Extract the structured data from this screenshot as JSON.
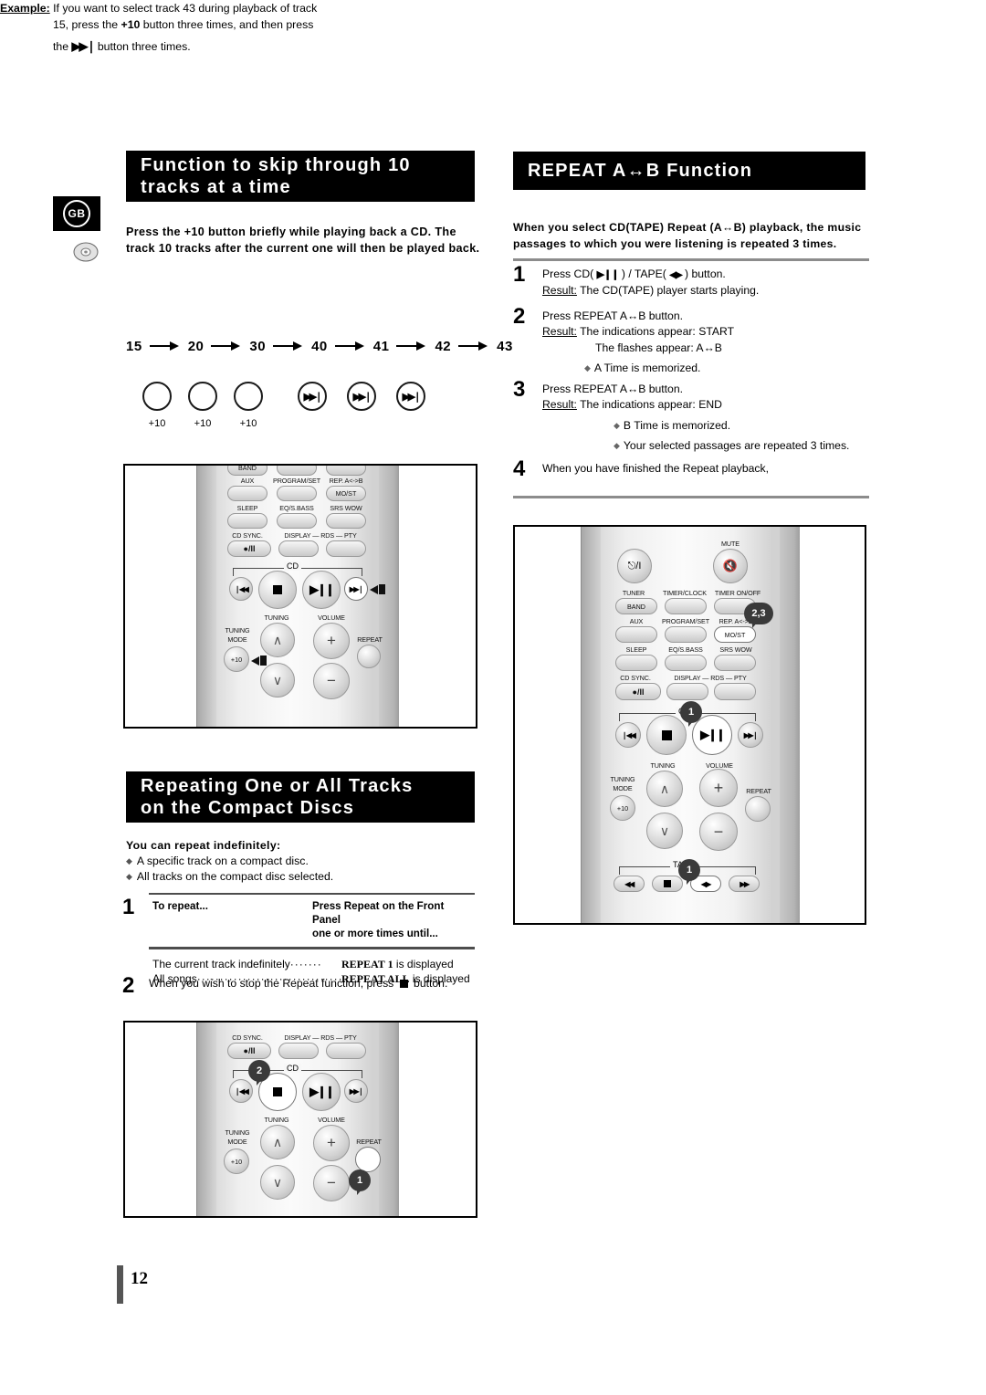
{
  "page": {
    "number": "12",
    "language_tab": "GB"
  },
  "sections": {
    "skip": {
      "title_line1": "Function to skip through 10",
      "title_line2": "tracks at a time",
      "intro": "Press the +10 button briefly while playing back a CD. The track 10 tracks after the current one will then be played back.",
      "example_label": "Example:",
      "example_line1": "If you want to select track 43 during playback of track",
      "example_line2_a": "15, press the ",
      "example_line2_b": "+10",
      "example_line2_c": " button three times, and then press",
      "example_line3_a": "the ",
      "example_line3_b": " button three times.",
      "flow": [
        "15",
        "20",
        "30",
        "40",
        "41",
        "42",
        "43"
      ],
      "button_captions": [
        "+10",
        "+10",
        "+10"
      ]
    },
    "repeat_ab": {
      "title": "REPEAT A↔B Function",
      "intro": "When you select CD(TAPE) Repeat (A↔B) playback, the music passages to which you were listening is repeated 3 times.",
      "steps": [
        {
          "num": "1",
          "line1_a": "Press CD( ",
          "line1_b": " ) / TAPE( ",
          "line1_c": " ) button.",
          "result_label": "Result:",
          "result_text": "The CD(TAPE) player starts playing."
        },
        {
          "num": "2",
          "line1": "Press REPEAT A↔B button.",
          "result_label": "Result:",
          "result_text": "The indications appear: START",
          "result_text2": "The flashes appear: A↔B",
          "bullets": [
            "A Time is memorized."
          ]
        },
        {
          "num": "3",
          "line1": "Press REPEAT A↔B button.",
          "result_label": "Result:",
          "result_text": "The indications appear:  END",
          "bullets": [
            "B Time is memorized.",
            "Your selected passages are repeated 3 times."
          ]
        },
        {
          "num": "4",
          "line1": "When you have finished the Repeat playback,"
        }
      ]
    },
    "repeat_tracks": {
      "title_line1": "Repeating One or All Tracks",
      "title_line2": "on the Compact Discs",
      "intro": "You can repeat indefinitely:",
      "bullets": [
        "A specific track on a compact disc.",
        "All tracks on the compact disc selected."
      ],
      "step1_num": "1",
      "table": {
        "header_left": "To repeat...",
        "header_right_line1": "Press Repeat on the Front Panel",
        "header_right_line2": "one or more times until...",
        "rows": [
          {
            "left": "The current track indefinitely",
            "dots": "·······",
            "right": "REPEAT 1",
            "right_tail": " is displayed"
          },
          {
            "left": "All songs",
            "dots": "································",
            "right": "REPEAT ALL",
            "right_tail": " is displayed"
          }
        ]
      },
      "step2_num": "2",
      "step2_text_a": "When you wish to stop the Repeat function, press ",
      "step2_text_b": " button."
    }
  },
  "remote_top_left": {
    "rows": [
      {
        "labels": [
          "",
          "",
          ""
        ],
        "buttons": [
          "BAND",
          "",
          ""
        ]
      },
      {
        "labels": [
          "AUX",
          "PROGRAM/SET",
          "REP. A<->B"
        ],
        "buttons": [
          "",
          "",
          "MO/ST"
        ]
      },
      {
        "labels": [
          "SLEEP",
          "EQ/S.BASS",
          "SRS WOW"
        ],
        "buttons": [
          "",
          "",
          ""
        ]
      },
      {
        "labels": [
          "CD SYNC.",
          "DISPLAY — RDS — PTY",
          ""
        ],
        "buttons": [
          "●/II",
          "",
          ""
        ]
      }
    ],
    "cd_label": "CD",
    "tuning_label": "TUNING",
    "volume_label": "VOLUME",
    "tuning_mode_label_1": "TUNING",
    "tuning_mode_label_2": "MODE",
    "plus10_label": "+10",
    "repeat_label": "REPEAT"
  },
  "remote_right": {
    "power_label": "/I",
    "mute_label": "MUTE",
    "rows": [
      {
        "labels": [
          "TUNER",
          "TIMER/CLOCK",
          "TIMER ON/OFF"
        ],
        "buttons": [
          "BAND",
          "",
          ""
        ]
      },
      {
        "labels": [
          "AUX",
          "PROGRAM/SET",
          "REP. A<->B"
        ],
        "buttons": [
          "",
          "",
          "MO/ST"
        ]
      },
      {
        "labels": [
          "SLEEP",
          "EQ/S.BASS",
          "SRS WOW"
        ],
        "buttons": [
          "",
          "",
          ""
        ]
      },
      {
        "labels": [
          "CD SYNC.",
          "DISPLAY — RDS — PTY",
          ""
        ],
        "buttons": [
          "●/II",
          "",
          ""
        ]
      }
    ],
    "cd_label": "CD",
    "tape_label": "TAPE",
    "tuning_label": "TUNING",
    "volume_label": "VOLUME",
    "tuning_mode_label_1": "TUNING",
    "tuning_mode_label_2": "MODE",
    "plus10_label": "+10",
    "repeat_label": "REPEAT",
    "callout_ab": "2,3",
    "callout_cd_play": "1",
    "callout_tape_play": "1"
  },
  "remote_bottom_left": {
    "row_labels": [
      "CD SYNC.",
      "DISPLAY — RDS — PTY"
    ],
    "cdsync_button": "●/II",
    "cd_label": "CD",
    "tuning_label": "TUNING",
    "volume_label": "VOLUME",
    "tuning_mode_label_1": "TUNING",
    "tuning_mode_label_2": "MODE",
    "plus10_label": "+10",
    "repeat_label": "REPEAT",
    "callout_stop": "2",
    "callout_repeat": "1"
  },
  "colors": {
    "header_bg": "#000000",
    "header_fg": "#ffffff",
    "rule": "#8c8c8c",
    "callout": "#3a3a3a"
  }
}
